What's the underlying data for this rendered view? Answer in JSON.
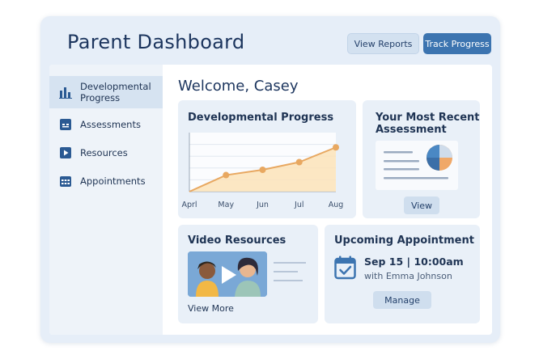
{
  "header": {
    "title": "Parent Dashboard",
    "view_reports_label": "View Reports",
    "track_progress_label": "Track Progress"
  },
  "sidebar": {
    "items": [
      {
        "label_line1": "Developmental",
        "label_line2": "Progress",
        "icon": "bar-chart-icon",
        "active": true
      },
      {
        "label_line1": "Assessments",
        "icon": "clipboard-icon",
        "active": false
      },
      {
        "label_line1": "Resources",
        "icon": "play-icon",
        "active": false
      },
      {
        "label_line1": "Appointments",
        "icon": "calendar-icon",
        "active": false
      }
    ]
  },
  "main": {
    "welcome": "Welcome, Casey",
    "progress_card": {
      "title": "Developmental Progress"
    },
    "assessment_card": {
      "title_line1": "Your Most Recent",
      "title_line2": "Assessment",
      "button_label": "View"
    },
    "video_card": {
      "title": "Video Resources",
      "link_label": "View More"
    },
    "appointment_card": {
      "title": "Upcoming Appointment",
      "date_time": "Sep 15 | 10:00am",
      "with": "with Emma Johnson",
      "button_label": "Manage"
    }
  },
  "colors": {
    "accent": "#3c74b0",
    "line": "#e8a861",
    "area": "#fbe3b9",
    "pie_blue": "#4a88c4",
    "pie_orange": "#f0a868"
  },
  "chart_data": {
    "type": "area",
    "categories": [
      "Aprl",
      "May",
      "Jun",
      "Jul",
      "Aug"
    ],
    "values": [
      0,
      28,
      37,
      50,
      75
    ],
    "ylim": [
      0,
      100
    ],
    "grid": true
  }
}
